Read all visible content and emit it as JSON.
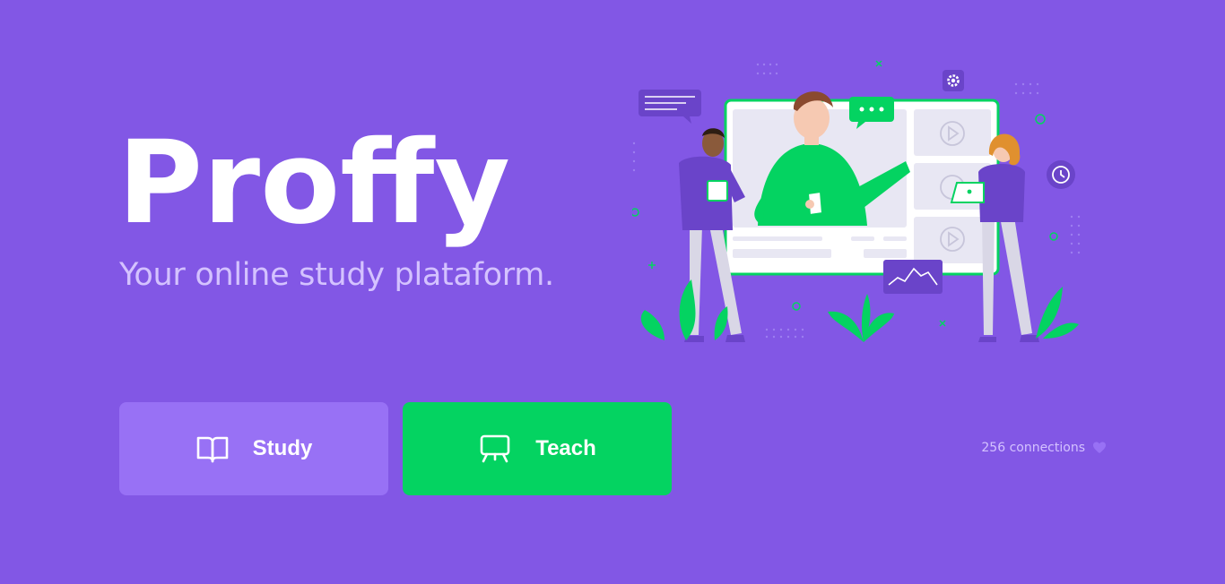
{
  "brand": {
    "logo_text": "Proffy",
    "tagline": "Your online study plataform."
  },
  "hero": {
    "illustration_icon": "online-classroom-illustration"
  },
  "actions": {
    "study": {
      "label": "Study",
      "icon": "book-open-icon"
    },
    "teach": {
      "label": "Teach",
      "icon": "presentation-board-icon"
    }
  },
  "footer": {
    "connections_text": "256 connections",
    "icon": "heart-icon"
  },
  "colors": {
    "background": "#8257e5",
    "study_button": "#9871f5",
    "teach_button": "#04d361",
    "text_light": "#d4c2ff",
    "white": "#ffffff"
  }
}
